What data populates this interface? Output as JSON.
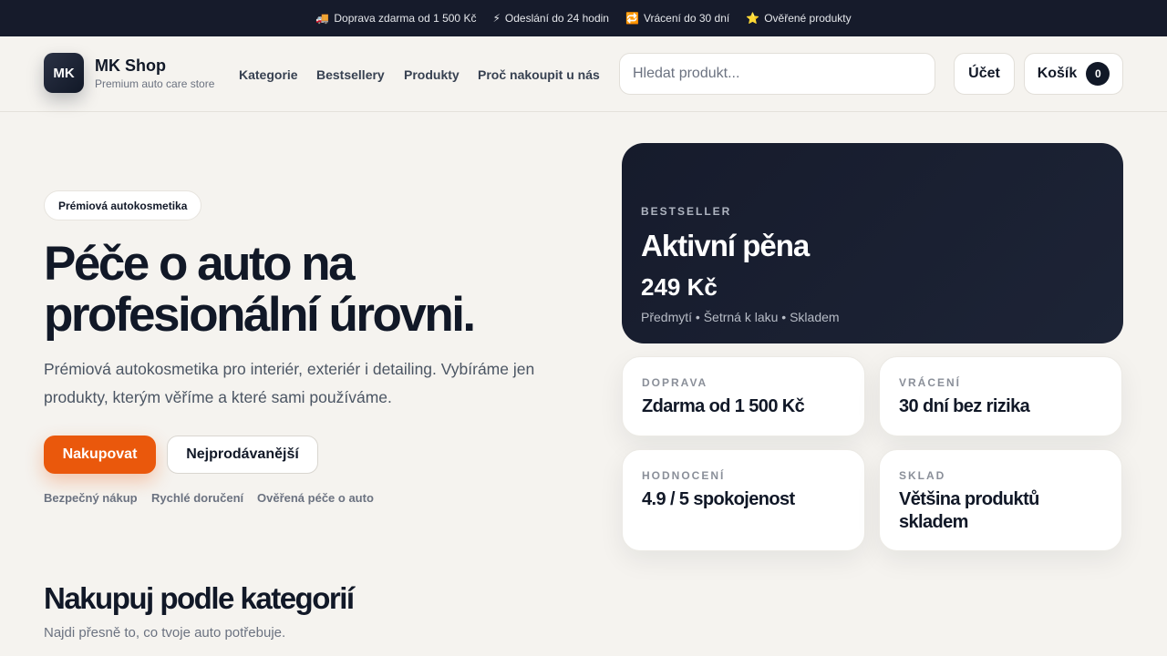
{
  "topbar": {
    "items": [
      {
        "emoji": "🚚",
        "text": "Doprava zdarma od 1 500 Kč"
      },
      {
        "emoji": "⚡",
        "text": "Odeslání do 24 hodin"
      },
      {
        "emoji": "🔁",
        "text": "Vrácení do 30 dní"
      },
      {
        "emoji": "⭐",
        "text": "Ověřené produkty"
      }
    ]
  },
  "header": {
    "logo": "MK",
    "brand_name": "MK Shop",
    "brand_tagline": "Premium auto care store",
    "nav": [
      "Kategorie",
      "Bestsellery",
      "Produkty",
      "Proč nakoupit u nás"
    ],
    "search_placeholder": "Hledat produkt...",
    "account_label": "Účet",
    "cart_label": "Košík",
    "cart_count": "0"
  },
  "hero": {
    "badge": "Prémiová autokosmetika",
    "title_line1": "Péče o auto na",
    "title_line2": "profesionální úrovni.",
    "subtitle": "Prémiová autokosmetika pro interiér, exteriér i detailing. Vybíráme jen produkty, kterým věříme a které sami používáme.",
    "primary_cta": "Nakupovat",
    "secondary_cta": "Nejprodávanější",
    "trust": [
      "Bezpečný nákup",
      "Rychlé doručení",
      "Ověřená péče o auto"
    ]
  },
  "featured": {
    "label": "BESTSELLER",
    "name": "Aktivní pěna",
    "price": "249 Kč",
    "meta": "Předmytí • Šetrná k laku • Skladem"
  },
  "info_cards": [
    {
      "label": "DOPRAVA",
      "value": "Zdarma od 1 500 Kč"
    },
    {
      "label": "VRÁCENÍ",
      "value": "30 dní bez rizika"
    },
    {
      "label": "HODNOCENÍ",
      "value": "4.9 / 5 spokojenost"
    },
    {
      "label": "SKLAD",
      "value": "Většina produktů skladem"
    }
  ],
  "categories": {
    "title": "Nakupuj podle kategorií",
    "subtitle": "Najdi přesně to, co tvoje auto potřebuje."
  },
  "colors": {
    "accent": "#ea580c",
    "dark": "#111827",
    "background": "#f5f3ef"
  }
}
